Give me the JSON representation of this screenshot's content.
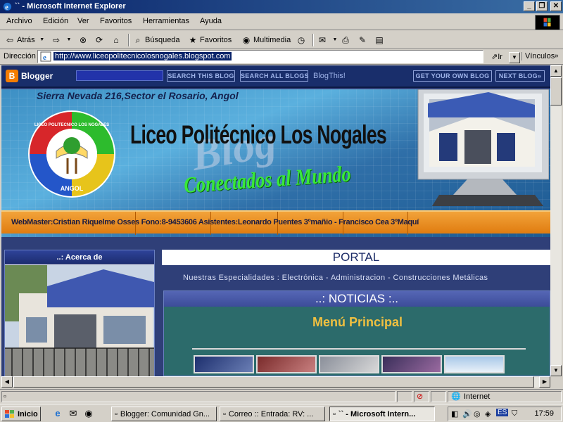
{
  "window": {
    "title": "`` - Microsoft Internet Explorer",
    "minimize": "_",
    "maximize": "❐",
    "close": "✕"
  },
  "menu": [
    "Archivo",
    "Edición",
    "Ver",
    "Favoritos",
    "Herramientas",
    "Ayuda"
  ],
  "toolbar": {
    "back": "Atrás",
    "search": "Búsqueda",
    "favorites": "Favoritos",
    "multimedia": "Multimedia"
  },
  "address": {
    "label": "Dirección",
    "url": "http://www.liceopolitecnicolosnogales.blogspot.com",
    "go": "Ir",
    "links": "Vínculos"
  },
  "blogger_nav": {
    "logo": "Blogger",
    "search_this_blog": "SEARCH THIS BLOG",
    "search_all_blogs": "SEARCH ALL BLOGS",
    "blog_this": "BlogThis!",
    "get_own_blog": "GET YOUR OWN BLOG",
    "next_blog": "NEXT BLOG»"
  },
  "banner": {
    "address": "Sierra Nevada 216,Sector el Rosario, Angol",
    "school_name": "Liceo Politécnico Los Nogales",
    "watermark": "Blog",
    "slogan": "Conectados al Mundo",
    "logo_text_top": "LICEO POLITECNICO LOS NOGALES",
    "logo_text_bottom": "ANGOL",
    "credits": "WebMaster:Cristian Riquelme Osses   Fono:8-9453606   Asistentes:Leonardo Puentes 3ºmañio - Francisco Cea 3ºMaquí"
  },
  "sidebar": {
    "title": "..: Acerca de"
  },
  "main": {
    "portal": "PORTAL",
    "specialties": "Nuestras Especialidades : Electrónica - Administracion - Construcciones Metálicas",
    "news_title": "..: NOTICIAS :..",
    "menu_title": "Menú Principal"
  },
  "status": {
    "zone": "Internet"
  },
  "taskbar": {
    "start": "Inicio",
    "tasks": [
      "Blogger: Comunidad Gn...",
      "Correo :: Entrada: RV: ...",
      "`` - Microsoft Intern..."
    ],
    "lang": "ES",
    "clock": "17:59"
  },
  "colors": {
    "titlebar": "#0a246a",
    "blogger_nav": "#192e6b",
    "page_bg": "#2f3f78",
    "news_bg": "#2c6b6b",
    "menu_title": "#f0c040",
    "slogan": "#39e839",
    "credits_bar": "#e07c10"
  }
}
